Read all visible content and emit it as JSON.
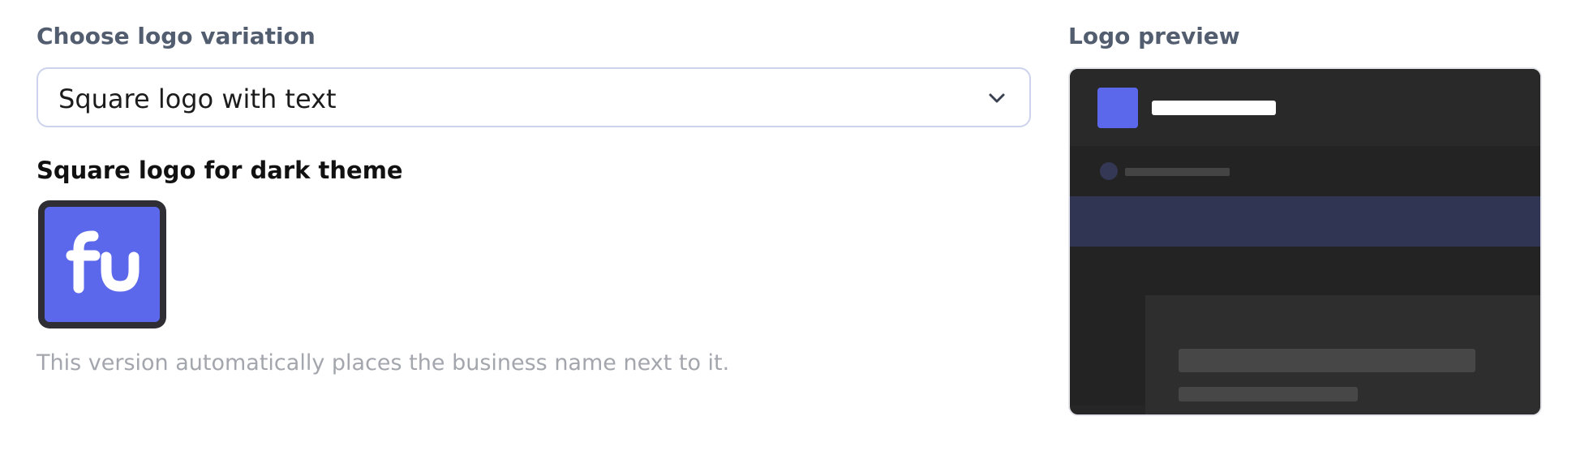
{
  "logo_variation": {
    "label": "Choose logo variation",
    "selected": "Square logo with text",
    "dropdown_icon": "chevron-down-icon"
  },
  "dark_theme": {
    "title": "Square logo for dark theme",
    "logo_text": "Fu",
    "help_text": "This version automatically places the business name next to it."
  },
  "preview": {
    "label": "Logo preview"
  },
  "colors": {
    "brand": "#5b68ec",
    "preview_background": "#262626",
    "preview_highlight": "#313554"
  }
}
